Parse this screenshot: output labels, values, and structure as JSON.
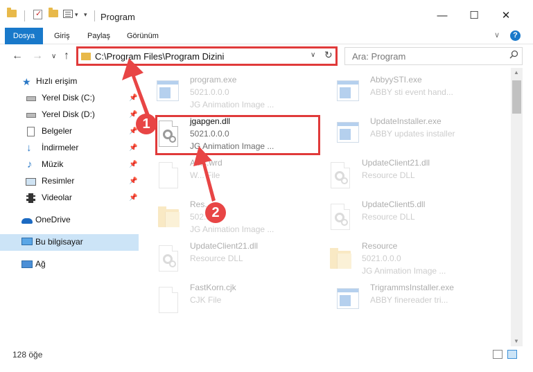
{
  "window": {
    "title": "Program",
    "minimize": "—",
    "maximize": "☐",
    "close": "✕"
  },
  "ribbon": {
    "file": "Dosya",
    "tabs": [
      "Giriş",
      "Paylaş",
      "Görünüm"
    ],
    "help": "?"
  },
  "nav": {
    "address": "C:\\Program Files\\Program Dizini",
    "search_placeholder": "Ara: Program"
  },
  "sidebar": {
    "items": [
      {
        "label": "Hızlı erişim",
        "icon": "star-icon",
        "pinned": false
      },
      {
        "label": "Yerel Disk (C:)",
        "icon": "drive-icon",
        "pinned": true
      },
      {
        "label": "Yerel Disk (D:)",
        "icon": "drive-icon",
        "pinned": true
      },
      {
        "label": "Belgeler",
        "icon": "documents-icon",
        "pinned": true
      },
      {
        "label": "İndirmeler",
        "icon": "download-icon",
        "pinned": true
      },
      {
        "label": "Müzik",
        "icon": "music-icon",
        "pinned": true
      },
      {
        "label": "Resimler",
        "icon": "pictures-icon",
        "pinned": true
      },
      {
        "label": "Videolar",
        "icon": "videos-icon",
        "pinned": true
      },
      {
        "label": "OneDrive",
        "icon": "cloud-icon",
        "pinned": false
      },
      {
        "label": "Bu bilgisayar",
        "icon": "computer-icon",
        "pinned": false,
        "selected": true
      },
      {
        "label": "Ağ",
        "icon": "network-icon",
        "pinned": false
      }
    ]
  },
  "files": [
    {
      "name": "program.exe",
      "line2": "5021.0.0.0",
      "line3": "JG Animation Image ...",
      "icon": "exe-icon",
      "faded": true
    },
    {
      "name": "AbbyySTI.exe",
      "line2": "ABBY sti event hand...",
      "line3": "",
      "icon": "exe-icon",
      "faded": true
    },
    {
      "name": "jgapgen.dll",
      "line2": "5021.0.0.0",
      "line3": "JG Animation Image ...",
      "icon": "dll-icon",
      "faded": false
    },
    {
      "name": "UpdateInstaller.exe",
      "line2": "ABBY updates installer",
      "line3": "",
      "icon": "exe-icon",
      "faded": true
    },
    {
      "name": "A...c.wrd",
      "line2": "W... File",
      "line3": "",
      "icon": "file-icon",
      "faded": true
    },
    {
      "name": "UpdateClient21.dll",
      "line2": "Resource DLL",
      "line3": "",
      "icon": "dll-icon",
      "faded": true
    },
    {
      "name": "Res...",
      "line2": "502...",
      "line3": "JG Animation Image ...",
      "icon": "folder-icon",
      "faded": true
    },
    {
      "name": "UpdateClient5.dll",
      "line2": "Resource DLL",
      "line3": "",
      "icon": "dll-icon",
      "faded": true
    },
    {
      "name": "UpdateClient21.dll",
      "line2": "Resource DLL",
      "line3": "",
      "icon": "dll-icon",
      "faded": true
    },
    {
      "name": "Resource",
      "line2": "5021.0.0.0",
      "line3": "JG Animation Image ...",
      "icon": "folder-icon",
      "faded": true
    },
    {
      "name": "FastKorn.cjk",
      "line2": "CJK File",
      "line3": "",
      "icon": "file-icon",
      "faded": true
    },
    {
      "name": "TrigrammsInstaller.exe",
      "line2": "ABBY finereader tri...",
      "line3": "",
      "icon": "exe-icon",
      "faded": true
    }
  ],
  "status": {
    "count": "128 öğe"
  },
  "annotations": {
    "badge1": "1",
    "badge2": "2",
    "color": "#e84545"
  }
}
